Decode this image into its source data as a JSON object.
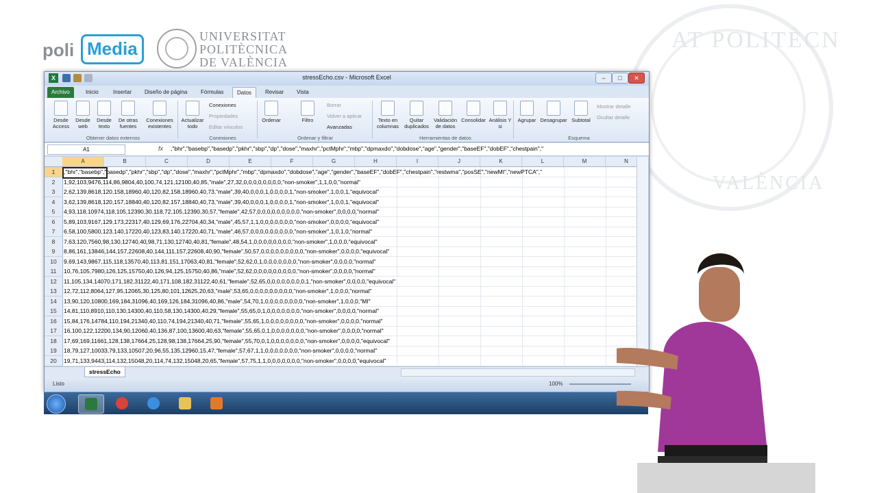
{
  "brand": {
    "poli": "poli",
    "media": "Media",
    "university_lines": [
      "UNIVERSITAT",
      "POLITÈCNICA",
      "DE VALÈNCIA"
    ],
    "seal_top": "AT POLITÈCN",
    "seal_bottom": "VALÈNCIA"
  },
  "window": {
    "title": "stressEcho.csv - Microsoft Excel"
  },
  "ribbon_tabs": [
    "Archivo",
    "Inicio",
    "Insertar",
    "Diseño de página",
    "Fórmulas",
    "Datos",
    "Revisar",
    "Vista"
  ],
  "ribbon": {
    "external": {
      "buttons": [
        "Desde Access",
        "Desde web",
        "Desde texto",
        "De otras fuentes"
      ],
      "label": "Obtener datos externos"
    },
    "connections": {
      "existing": "Conexiones existentes",
      "refresh": "Actualizar todo",
      "conn": "Conexiones",
      "props": "Propiedades",
      "edit": "Editar vínculos",
      "label": "Conexiones"
    },
    "sort": {
      "sort": "Ordenar",
      "filter": "Filtro",
      "clear": "Borrar",
      "reapply": "Volver a aplicar",
      "advanced": "Avanzadas",
      "label": "Ordenar y filtrar"
    },
    "tools": {
      "buttons": [
        "Texto en columnas",
        "Quitar duplicados",
        "Validación de datos",
        "Consolidar",
        "Análisis Y si"
      ],
      "label": "Herramientas de datos"
    },
    "outline": {
      "buttons": [
        "Agrupar",
        "Desagrupar",
        "Subtotal"
      ],
      "show": "Mostrar detalle",
      "hide": "Ocultar detalle",
      "label": "Esquema"
    }
  },
  "formula_bar": {
    "name_box": "A1",
    "fx": "fx",
    "formula": ",\"bhr\",\"basebp\",\"basedp\",\"pkhr\",\"sbp\",\"dp\",\"dose\",\"maxhr\",\"pctMphr\",\"mbp\",\"dpmaxdo\",\"dobdose\",\"age\",\"gender\",\"baseEF\",\"dobEF\",\"chestpain\",\""
  },
  "columns": [
    "A",
    "B",
    "C",
    "D",
    "E",
    "F",
    "G",
    "H",
    "I",
    "J",
    "K",
    "L",
    "M",
    "N"
  ],
  "rows": [
    ",\"bhr\",\"basebp\",\"basedp\",\"pkhr\",\"sbp\",\"dp\",\"dose\",\"maxhr\",\"pctMphr\",\"mbp\",\"dpmaxdo\",\"dobdose\",\"age\",\"gender\",\"baseEF\",\"dobEF\",\"chestpain\",\"restwma\",\"posSE\",\"newMI\",\"newPTCA\",\"",
    "1,92,103,9476,114,86,9804,40,100,74,121,12100,40,85,\"male\",27,32,0,0,0,0,0,0,0,0,\"non-smoker\",1,1,0,0,\"normal\"",
    "2,62,139,8618,120,158,18960,40,120,82,158,18960,40,73,\"male\",39,40,0,0,0,1,0,0,0,0,1,\"non-smoker\",1,0,0,1,\"equivocal\"",
    "3,62,139,8618,120,157,18840,40,120,82,157,18840,40,73,\"male\",39,40,0,0,0,1,0,0,0,0,1,\"non-smoker\",1,0,0,1,\"equivocal\"",
    "4,93,118,10974,118,105,12390,30,118,72,105,12390,30,57,\"female\",42,57,0,0,0,0,0,0,0,0,0,\"non-smoker\",0,0,0,0,\"normal\"",
    "5,89,103,9167,129,173,22317,40,129,69,176,22704,40,34,\"male\",45,57,1,1,0,0,0,0,0,0,0,\"non-smoker\",0,0,0,0,\"equivocal\"",
    "6,58,100,5800,123,140,17220,40,123,83,140,17220,40,71,\"male\",46,57,0,0,0,0,0,0,0,0,0,\"non-smoker\",1,0,1,0,\"normal\"",
    "7,63,120,7560,98,130,12740,40,98,71,130,12740,40,81,\"female\",48,54,1,0,0,0,0,0,0,0,0,\"non-smoker\",1,0,0,0,\"equivocal\"",
    "8,86,161,13846,144,157,22608,40,144,111,157,22608,40,90,\"female\",50,57,0,0,0,0,0,0,0,0,0,\"non-smoker\",0,0,0,0,\"equivocal\"",
    "9,69,143,9867,115,118,13570,40,113,81,151,17063,40,81,\"female\",52,62,0,1,0,0,0,0,0,0,0,\"non-smoker\",0,0,0,0,\"normal\"",
    "10,76,105,7980,126,125,15750,40,126,94,125,15750,40,86,\"male\",52,62,0,0,0,0,0,0,0,0,0,\"non-smoker\",0,0,0,0,\"normal\"",
    "11,105,134,14070,171,182,31122,40,171,108,182,31122,40,61,\"female\",52,65,0,0,0,0,0,0,0,0,1,\"non-smoker\",0,0,0,0,\"equivocal\"",
    "12,72,112,8064,127,95,12065,30,125,80,101,12625,20,63,\"male\",53,65,0,0,0,0,0,0,0,0,0,\"non-smoker\",1,0,0,0,\"normal\"",
    "13,90,120,10800,169,184,31096,40,169,126,184,31096,40,86,\"male\",54,70,1,0,0,0,0,0,0,0,0,\"non-smoker\",1,0,0,0,\"MI\"",
    "14,81,110,8910,110,130,14300,40,110,58,130,14300,40,29,\"female\",55,65,0,1,0,0,0,0,0,0,0,\"non-smoker\",0,0,0,0,\"normal\"",
    "15,84,176,14784,110,194,21340,40,110,74,194,21340,40,71,\"female\",55,65,1,0,0,0,0,0,0,0,0,\"non-smoker\",0,0,0,0,\"normal\"",
    "16,100,122,12200,134,90,12060,40,136,87,100,13600,40,63,\"female\",55,65,0,1,0,0,0,0,0,0,0,\"non-smoker\",0,0,0,0,\"normal\"",
    "17,69,169,11661,128,138,17664,25,128,98,138,17664,25,90,\"female\",55,70,0,1,0,0,0,0,0,0,0,\"non-smoker\",0,0,0,0,\"equivocal\"",
    "18,79,127,10033,79,133,10507,20,96,55,135,12960,15,47,\"female\",57,67,1,1,0,0,0,0,0,0,0,\"non-smoker\",0,0,0,0,\"normal\"",
    "19,71,133,9443,114,132,15048,20,114,74,132,15048,20,65,\"female\",57,75,1,1,0,0,0,0,0,0,0,\"non-smoker\",0,0,0,0,\"equivocal\""
  ],
  "sheet_tab": "stressEcho",
  "status": {
    "text": "Listo",
    "zoom": "100%"
  },
  "colors": {
    "excel_green": "#2b7a3d",
    "brand_blue": "#2a9fd6",
    "selection": "#f7d58c"
  }
}
